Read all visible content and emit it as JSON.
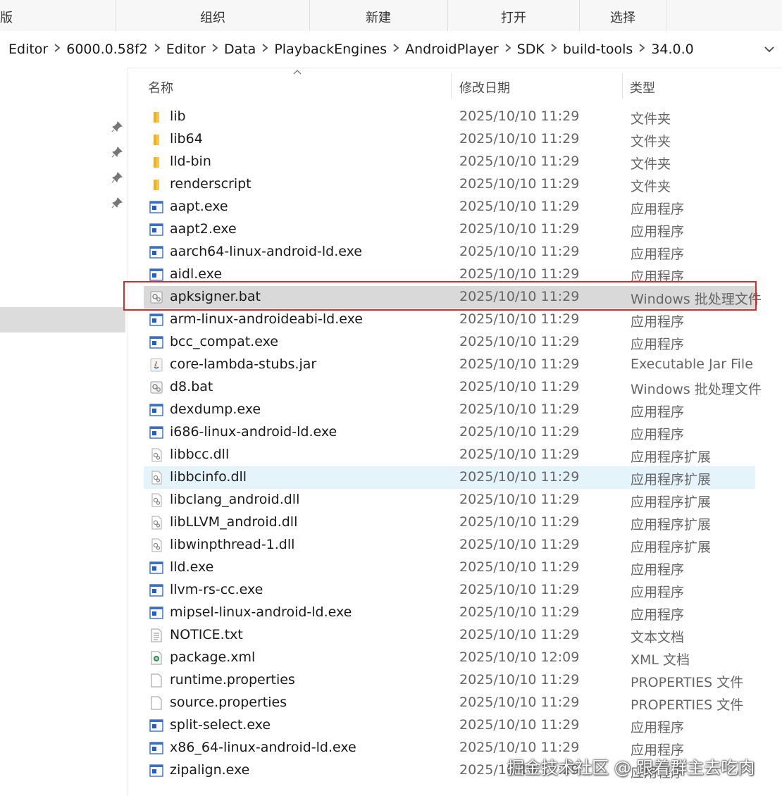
{
  "ribbon": {
    "left_fragment": "版",
    "groups": [
      "组织",
      "新建",
      "打开",
      "选择"
    ]
  },
  "breadcrumb": [
    "Editor",
    "6000.0.58f2",
    "Editor",
    "Data",
    "PlaybackEngines",
    "AndroidPlayer",
    "SDK",
    "build-tools",
    "34.0.0"
  ],
  "columns": {
    "name": "名称",
    "date": "修改日期",
    "type": "类型"
  },
  "files": [
    {
      "name": "lib",
      "date": "2025/10/10 11:29",
      "type": "文件夹",
      "icon": "folder-icon"
    },
    {
      "name": "lib64",
      "date": "2025/10/10 11:29",
      "type": "文件夹",
      "icon": "folder-icon"
    },
    {
      "name": "lld-bin",
      "date": "2025/10/10 11:29",
      "type": "文件夹",
      "icon": "folder-icon"
    },
    {
      "name": "renderscript",
      "date": "2025/10/10 11:29",
      "type": "文件夹",
      "icon": "folder-icon"
    },
    {
      "name": "aapt.exe",
      "date": "2025/10/10 11:29",
      "type": "应用程序",
      "icon": "exe-icon"
    },
    {
      "name": "aapt2.exe",
      "date": "2025/10/10 11:29",
      "type": "应用程序",
      "icon": "exe-icon"
    },
    {
      "name": "aarch64-linux-android-ld.exe",
      "date": "2025/10/10 11:29",
      "type": "应用程序",
      "icon": "exe-icon"
    },
    {
      "name": "aidl.exe",
      "date": "2025/10/10 11:29",
      "type": "应用程序",
      "icon": "exe-icon"
    },
    {
      "name": "apksigner.bat",
      "date": "2025/10/10 11:29",
      "type": "Windows 批处理文件",
      "icon": "bat-icon",
      "selected": true
    },
    {
      "name": "arm-linux-androideabi-ld.exe",
      "date": "2025/10/10 11:29",
      "type": "应用程序",
      "icon": "exe-icon"
    },
    {
      "name": "bcc_compat.exe",
      "date": "2025/10/10 11:29",
      "type": "应用程序",
      "icon": "exe-icon"
    },
    {
      "name": "core-lambda-stubs.jar",
      "date": "2025/10/10 11:29",
      "type": "Executable Jar File",
      "icon": "jar-icon"
    },
    {
      "name": "d8.bat",
      "date": "2025/10/10 11:29",
      "type": "Windows 批处理文件",
      "icon": "bat-icon"
    },
    {
      "name": "dexdump.exe",
      "date": "2025/10/10 11:29",
      "type": "应用程序",
      "icon": "exe-icon"
    },
    {
      "name": "i686-linux-android-ld.exe",
      "date": "2025/10/10 11:29",
      "type": "应用程序",
      "icon": "exe-icon"
    },
    {
      "name": "libbcc.dll",
      "date": "2025/10/10 11:29",
      "type": "应用程序扩展",
      "icon": "dll-icon"
    },
    {
      "name": "libbcinfo.dll",
      "date": "2025/10/10 11:29",
      "type": "应用程序扩展",
      "icon": "dll-icon",
      "hover": true
    },
    {
      "name": "libclang_android.dll",
      "date": "2025/10/10 11:29",
      "type": "应用程序扩展",
      "icon": "dll-icon"
    },
    {
      "name": "libLLVM_android.dll",
      "date": "2025/10/10 11:29",
      "type": "应用程序扩展",
      "icon": "dll-icon"
    },
    {
      "name": "libwinpthread-1.dll",
      "date": "2025/10/10 11:29",
      "type": "应用程序扩展",
      "icon": "dll-icon"
    },
    {
      "name": "lld.exe",
      "date": "2025/10/10 11:29",
      "type": "应用程序",
      "icon": "exe-icon"
    },
    {
      "name": "llvm-rs-cc.exe",
      "date": "2025/10/10 11:29",
      "type": "应用程序",
      "icon": "exe-icon"
    },
    {
      "name": "mipsel-linux-android-ld.exe",
      "date": "2025/10/10 11:29",
      "type": "应用程序",
      "icon": "exe-icon"
    },
    {
      "name": "NOTICE.txt",
      "date": "2025/10/10 11:29",
      "type": "文本文档",
      "icon": "txt-icon"
    },
    {
      "name": "package.xml",
      "date": "2025/10/10 12:09",
      "type": "XML 文档",
      "icon": "xml-icon"
    },
    {
      "name": "runtime.properties",
      "date": "2025/10/10 11:29",
      "type": "PROPERTIES 文件",
      "icon": "blank-file-icon"
    },
    {
      "name": "source.properties",
      "date": "2025/10/10 11:29",
      "type": "PROPERTIES 文件",
      "icon": "blank-file-icon"
    },
    {
      "name": "split-select.exe",
      "date": "2025/10/10 11:29",
      "type": "应用程序",
      "icon": "exe-icon"
    },
    {
      "name": "x86_64-linux-android-ld.exe",
      "date": "2025/10/10 11:29",
      "type": "应用程序",
      "icon": "exe-icon"
    },
    {
      "name": "zipalign.exe",
      "date": "2025/10/10 11:29",
      "type": "应用程序",
      "icon": "exe-icon"
    }
  ],
  "watermark": "掘金技术社区 @ 跟着群主去吃肉",
  "colors": {
    "selected_row": "#d9d9d9",
    "hover_row": "#e5f3fb",
    "highlight_border": "#d92b2b",
    "folder": "#f4c842",
    "exe_blue": "#1f5fbf"
  }
}
